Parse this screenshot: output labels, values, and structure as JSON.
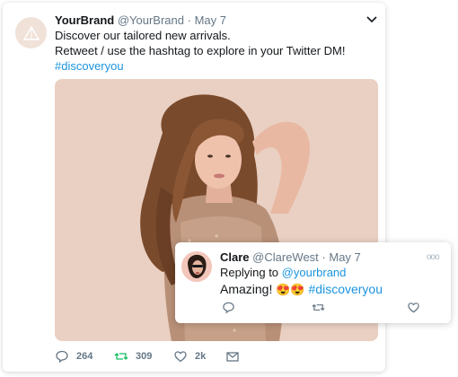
{
  "tweet": {
    "brand_name": "YourBrand",
    "handle": "@YourBrand",
    "separator": " · ",
    "date": "May 7",
    "line1": "Discover our tailored new arrivals.",
    "line2": "Retweet / use the hashtag to explore in your Twitter DM!",
    "hashtag": "#discoveryou",
    "image_alt": "photo-woman-sequin-dress",
    "stats": {
      "replies": "264",
      "retweets": "309",
      "likes": "2k"
    }
  },
  "reply": {
    "name": "Clare",
    "handle": "@ClareWest",
    "separator": " · ",
    "date": "May 7",
    "replying_to_label": "Replying to ",
    "replying_to_handle": "@yourbrand",
    "text": "Amazing! ",
    "emojis": "😍😍",
    "hashtag": "#discoveryou",
    "more": "ooo"
  },
  "colors": {
    "accent": "#1b95e0",
    "muted": "#657786",
    "photo_bg": "#ead0c2"
  },
  "icons": [
    "brand-logo-icon",
    "chevron-down-icon",
    "reply-icon",
    "retweet-icon",
    "like-icon",
    "mail-icon",
    "more-icon"
  ]
}
